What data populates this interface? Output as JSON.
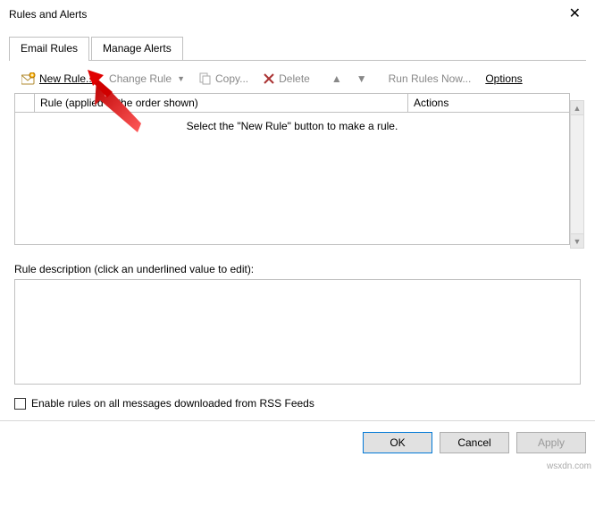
{
  "window": {
    "title": "Rules and Alerts"
  },
  "tabs": {
    "email_rules": "Email Rules",
    "manage_alerts": "Manage Alerts"
  },
  "toolbar": {
    "new_rule": "New Rule...",
    "change_rule": "Change Rule",
    "copy": "Copy...",
    "delete": "Delete",
    "run_rules_now": "Run Rules Now...",
    "options": "Options"
  },
  "columns": {
    "rule": "Rule (applied in the order shown)",
    "actions": "Actions"
  },
  "list": {
    "empty_text": "Select the \"New Rule\" button to make a rule."
  },
  "description": {
    "label": "Rule description (click an underlined value to edit):"
  },
  "rss": {
    "label": "Enable rules on all messages downloaded from RSS Feeds"
  },
  "buttons": {
    "ok": "OK",
    "cancel": "Cancel",
    "apply": "Apply"
  },
  "watermark": "wsxdn.com"
}
